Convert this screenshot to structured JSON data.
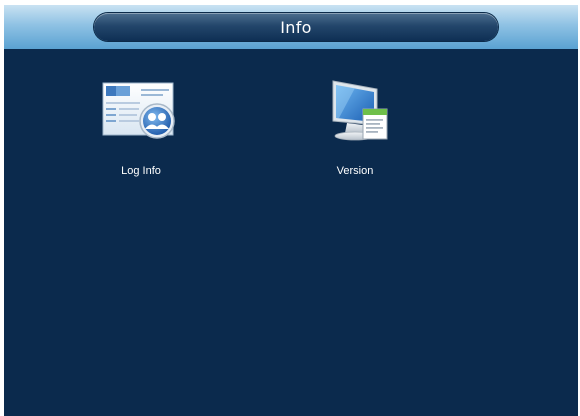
{
  "window": {
    "title": "Info"
  },
  "tiles": [
    {
      "label": "Log Info",
      "icon": "log-info-icon"
    },
    {
      "label": "Version",
      "icon": "version-icon"
    }
  ],
  "colors": {
    "background": "#0b2a4d",
    "titlebar": "#8fc2e4",
    "title_pill": "#23466b",
    "text": "#ffffff"
  }
}
